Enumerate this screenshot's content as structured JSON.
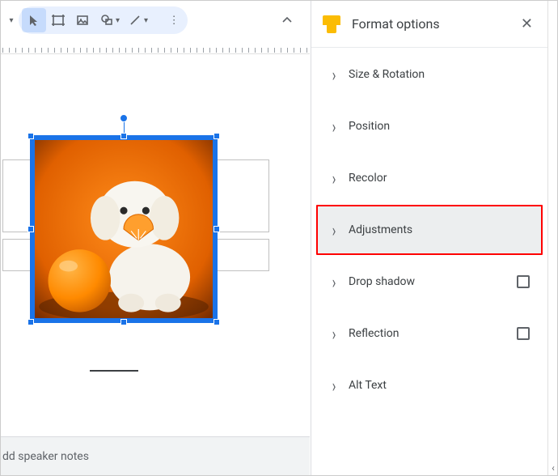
{
  "toolbar": {
    "selected_tool": "select",
    "tools": [
      "select",
      "textbox",
      "image",
      "shape",
      "line"
    ]
  },
  "sidepanel": {
    "title": "Format options",
    "rows": [
      {
        "key": "size_rotation",
        "label": "Size & Rotation",
        "checkbox": false,
        "highlighted": false
      },
      {
        "key": "position",
        "label": "Position",
        "checkbox": false,
        "highlighted": false
      },
      {
        "key": "recolor",
        "label": "Recolor",
        "checkbox": false,
        "highlighted": false
      },
      {
        "key": "adjustments",
        "label": "Adjustments",
        "checkbox": false,
        "highlighted": true
      },
      {
        "key": "drop_shadow",
        "label": "Drop shadow",
        "checkbox": true,
        "highlighted": false
      },
      {
        "key": "reflection",
        "label": "Reflection",
        "checkbox": true,
        "highlighted": false
      },
      {
        "key": "alt_text",
        "label": "Alt Text",
        "checkbox": false,
        "highlighted": false
      }
    ]
  },
  "speaker_notes_placeholder": "dd speaker notes"
}
